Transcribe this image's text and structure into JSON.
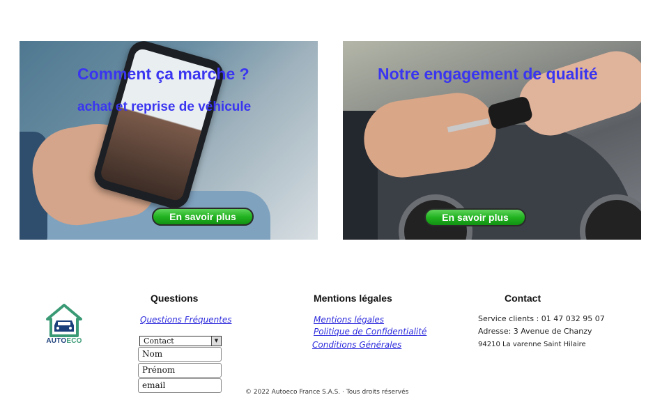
{
  "cards": [
    {
      "title": "Comment ça marche ?",
      "subtitle": "achat et reprise de véhicule",
      "button": "En savoir plus"
    },
    {
      "title": "Notre engagement de qualité",
      "button": "En savoir plus"
    }
  ],
  "footer": {
    "logo": {
      "brand_main": "AUTO",
      "brand_accent": "ECO",
      "icon": "house-car-icon",
      "colors": {
        "house": "#3a9a75",
        "car": "#1a3f7a"
      }
    },
    "questions": {
      "title": "Questions",
      "faq_link": "Questions Fréquentes",
      "select_value": "Contact",
      "inputs": {
        "nom": "Nom",
        "prenom": "Prénom",
        "email": "email"
      }
    },
    "mentions": {
      "title": "Mentions légales",
      "links": [
        "Mentions légales",
        "Politique de Confidentialité",
        "Conditions Générales"
      ]
    },
    "contact": {
      "title": "Contact",
      "service": "Service clients : 01 47 032 95 07",
      "address": "Adresse: 3 Avenue de Chanzy",
      "city": "94210 La varenne Saint Hilaire"
    },
    "copyright": "© 2022 Autoeco France S.A.S. · Tous droits réservés"
  },
  "colors": {
    "title_blue": "#3a35f0",
    "button_green": "#22b321",
    "link_blue": "#2d2bdc"
  }
}
